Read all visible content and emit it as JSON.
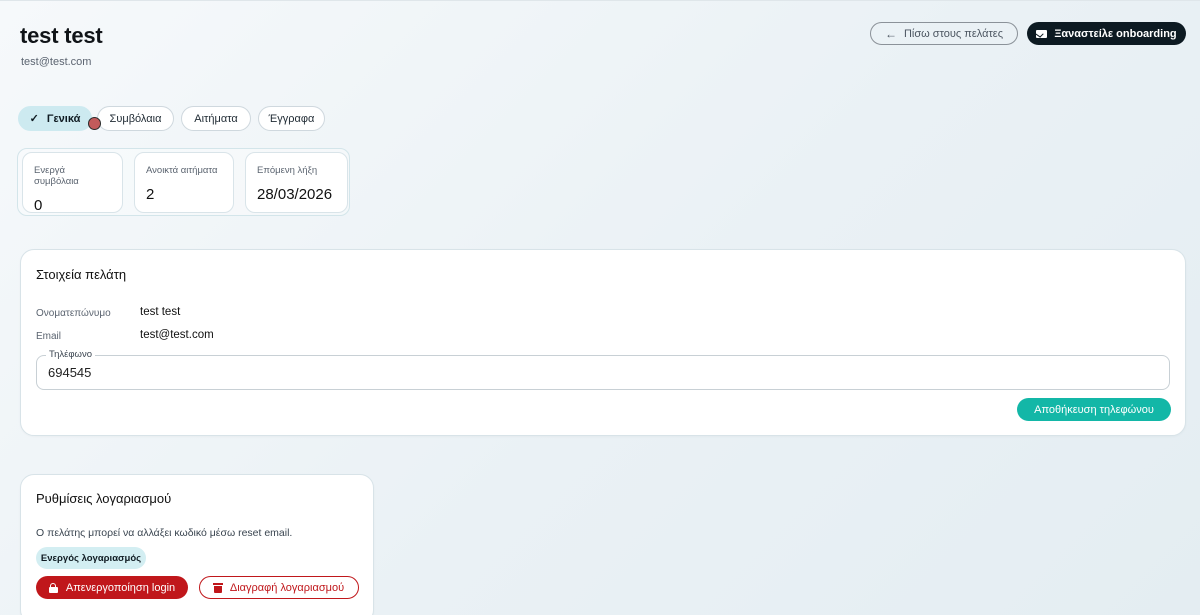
{
  "header": {
    "title": "test test",
    "subtitle": "test@test.com",
    "back_button": "Πίσω στους πελάτες",
    "onboarding_button": "Ξαναστείλε onboarding"
  },
  "tabs": [
    {
      "label": "Γενικά",
      "active": true
    },
    {
      "label": "Συμβόλαια",
      "active": false
    },
    {
      "label": "Αιτήματα",
      "active": false
    },
    {
      "label": "Έγγραφα",
      "active": false
    }
  ],
  "stats": [
    {
      "label": "Ενεργά συμβόλαια",
      "value": "0"
    },
    {
      "label": "Ανοικτά αιτήματα",
      "value": "2"
    },
    {
      "label": "Επόμενη λήξη",
      "value": "28/03/2026"
    }
  ],
  "customer_card": {
    "title": "Στοιχεία πελάτη",
    "fullname_label": "Ονοματεπώνυμο",
    "fullname_value": "test test",
    "email_label": "Email",
    "email_value": "test@test.com",
    "phone_label": "Τηλέφωνο",
    "phone_value": "694545",
    "save_phone_button": "Αποθήκευση τηλεφώνου"
  },
  "account_card": {
    "title": "Ρυθμίσεις λογαριασμού",
    "info": "Ο πελάτης μπορεί να αλλάξει κωδικό μέσω reset email.",
    "status_badge": "Ενεργός λογαριασμός",
    "disable_login_button": "Απενεργοποίηση login",
    "delete_account_button": "Διαγραφή λογαριασμού"
  },
  "colors": {
    "accent_teal": "#13b7a7",
    "danger": "#c0171b",
    "dark_button": "#0d1a22",
    "active_tab": "#cdeaf0"
  }
}
